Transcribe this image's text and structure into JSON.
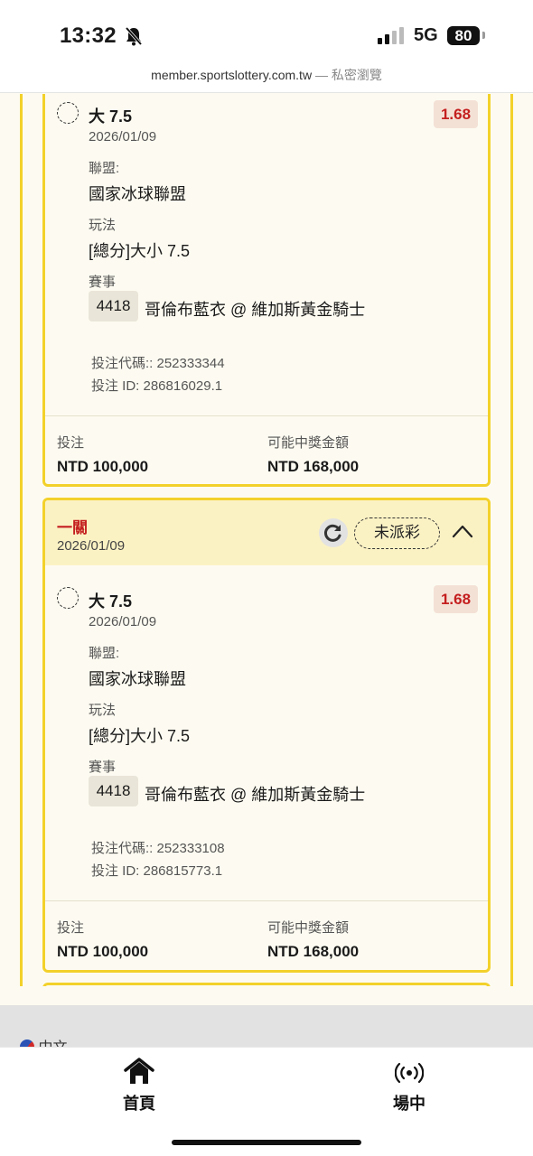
{
  "status_bar": {
    "time": "13:32",
    "network": "5G",
    "battery": "80"
  },
  "browser": {
    "url": "member.sportslottery.com.tw",
    "separator": "—",
    "mode": "私密瀏覽"
  },
  "labels": {
    "league": "聯盟:",
    "play": "玩法",
    "event": "賽事",
    "stake": "投注",
    "payout": "可能中獎金額"
  },
  "cards": [
    {
      "selection": "大 7.5",
      "odds": "1.68",
      "date": "2026/01/09",
      "league": "國家冰球聯盟",
      "play": "[總分]大小 7.5",
      "event_id": "4418",
      "event_name": "哥倫布藍衣 @ 維加斯黃金騎士",
      "bet_code": "投注代碼:: 252333344",
      "bet_id": "投注 ID: 286816029.1",
      "stake": "NTD 100,000",
      "payout": "NTD 168,000"
    },
    {
      "header_title": "一關",
      "header_date": "2026/01/09",
      "status": "未派彩",
      "selection": "大 7.5",
      "odds": "1.68",
      "date": "2026/01/09",
      "league": "國家冰球聯盟",
      "play": "[總分]大小 7.5",
      "event_id": "4418",
      "event_name": "哥倫布藍衣 @ 維加斯黃金騎士",
      "bet_code": "投注代碼:: 252333108",
      "bet_id": "投注 ID: 286815773.1",
      "stake": "NTD 100,000",
      "payout": "NTD 168,000"
    }
  ],
  "language": {
    "label": "中文"
  },
  "tabs": [
    {
      "label": "首頁",
      "icon": "home-icon"
    },
    {
      "label": "場中",
      "icon": "live-broadcast-icon"
    }
  ]
}
